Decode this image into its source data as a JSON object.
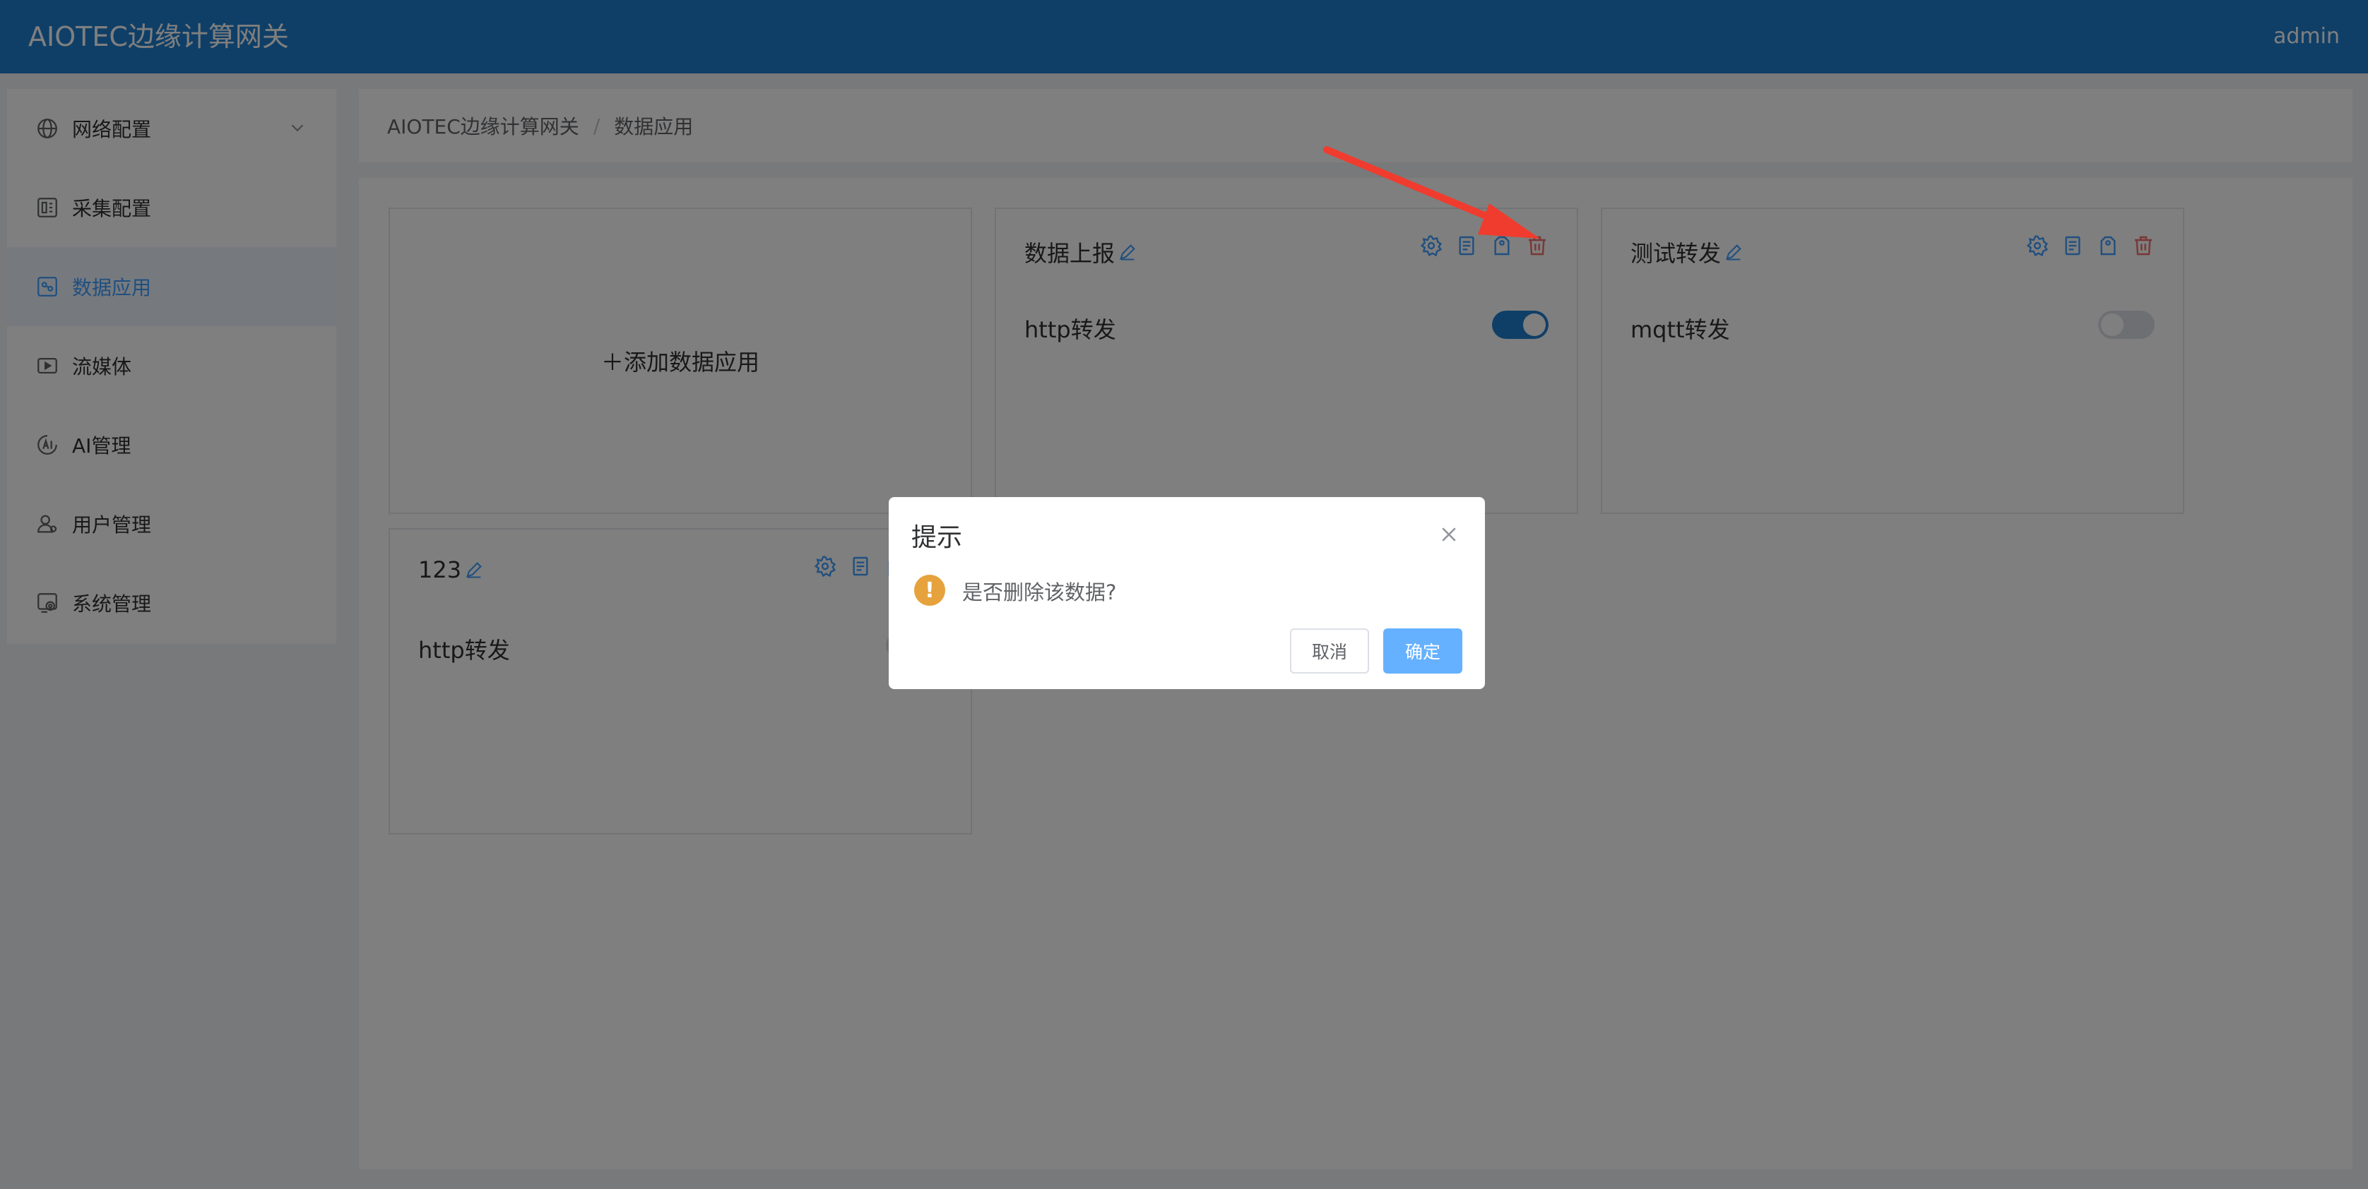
{
  "header": {
    "brand": "AIOTEC边缘计算网关",
    "user": "admin"
  },
  "sidebar": {
    "items": [
      {
        "label": "网络配置",
        "icon": "globe-icon"
      },
      {
        "label": "采集配置",
        "icon": "collect-icon"
      },
      {
        "label": "数据应用",
        "icon": "data-app-icon",
        "active": true
      },
      {
        "label": "流媒体",
        "icon": "video-icon"
      },
      {
        "label": "AI管理",
        "icon": "ai-icon"
      },
      {
        "label": "用户管理",
        "icon": "user-icon"
      },
      {
        "label": "系统管理",
        "icon": "system-icon"
      }
    ]
  },
  "breadcrumb": {
    "root": "AIOTEC边缘计算网关",
    "separator": "/",
    "current": "数据应用"
  },
  "cards": {
    "add_label": "＋添加数据应用",
    "items": [
      {
        "title": "数据上报",
        "type": "http转发",
        "enabled": true
      },
      {
        "title": "测试转发",
        "type": "mqtt转发",
        "enabled": false
      },
      {
        "title": "123",
        "type": "http转发"
      }
    ]
  },
  "dialog": {
    "title": "提示",
    "message": "是否删除该数据?",
    "warn_symbol": "!",
    "cancel": "取消",
    "confirm": "确定"
  },
  "colors": {
    "header": "#1f7fcf",
    "accent": "#409eff",
    "delete": "#f56c6c",
    "warning": "#e6a23c",
    "annotation_arrow": "#f03c2e"
  }
}
